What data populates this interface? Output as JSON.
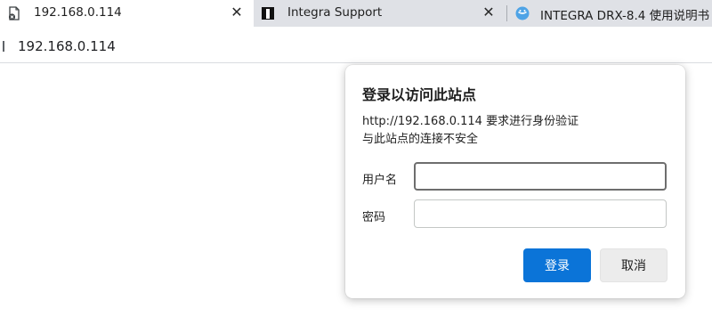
{
  "tabs": [
    {
      "title": "192.168.0.114",
      "icon": "page-error-icon",
      "close": "✕"
    },
    {
      "title": "Integra Support",
      "icon": "integra-logo-icon",
      "close": "✕"
    },
    {
      "title": "INTEGRA DRX-8.4 使用说明书",
      "icon": "manual-globe-icon"
    }
  ],
  "address": {
    "url": "192.168.0.114"
  },
  "auth_dialog": {
    "title": "登录以访问此站点",
    "message_line1": "http://192.168.0.114 要求进行身份验证",
    "message_line2": "与此站点的连接不安全",
    "username_label": "用户名",
    "username_value": "",
    "password_label": "密码",
    "password_value": "",
    "login_button": "登录",
    "cancel_button": "取消"
  },
  "colors": {
    "accent": "#0b74d8",
    "inactive_tab": "#dfe1e6",
    "cancel_bg": "#ececec"
  }
}
